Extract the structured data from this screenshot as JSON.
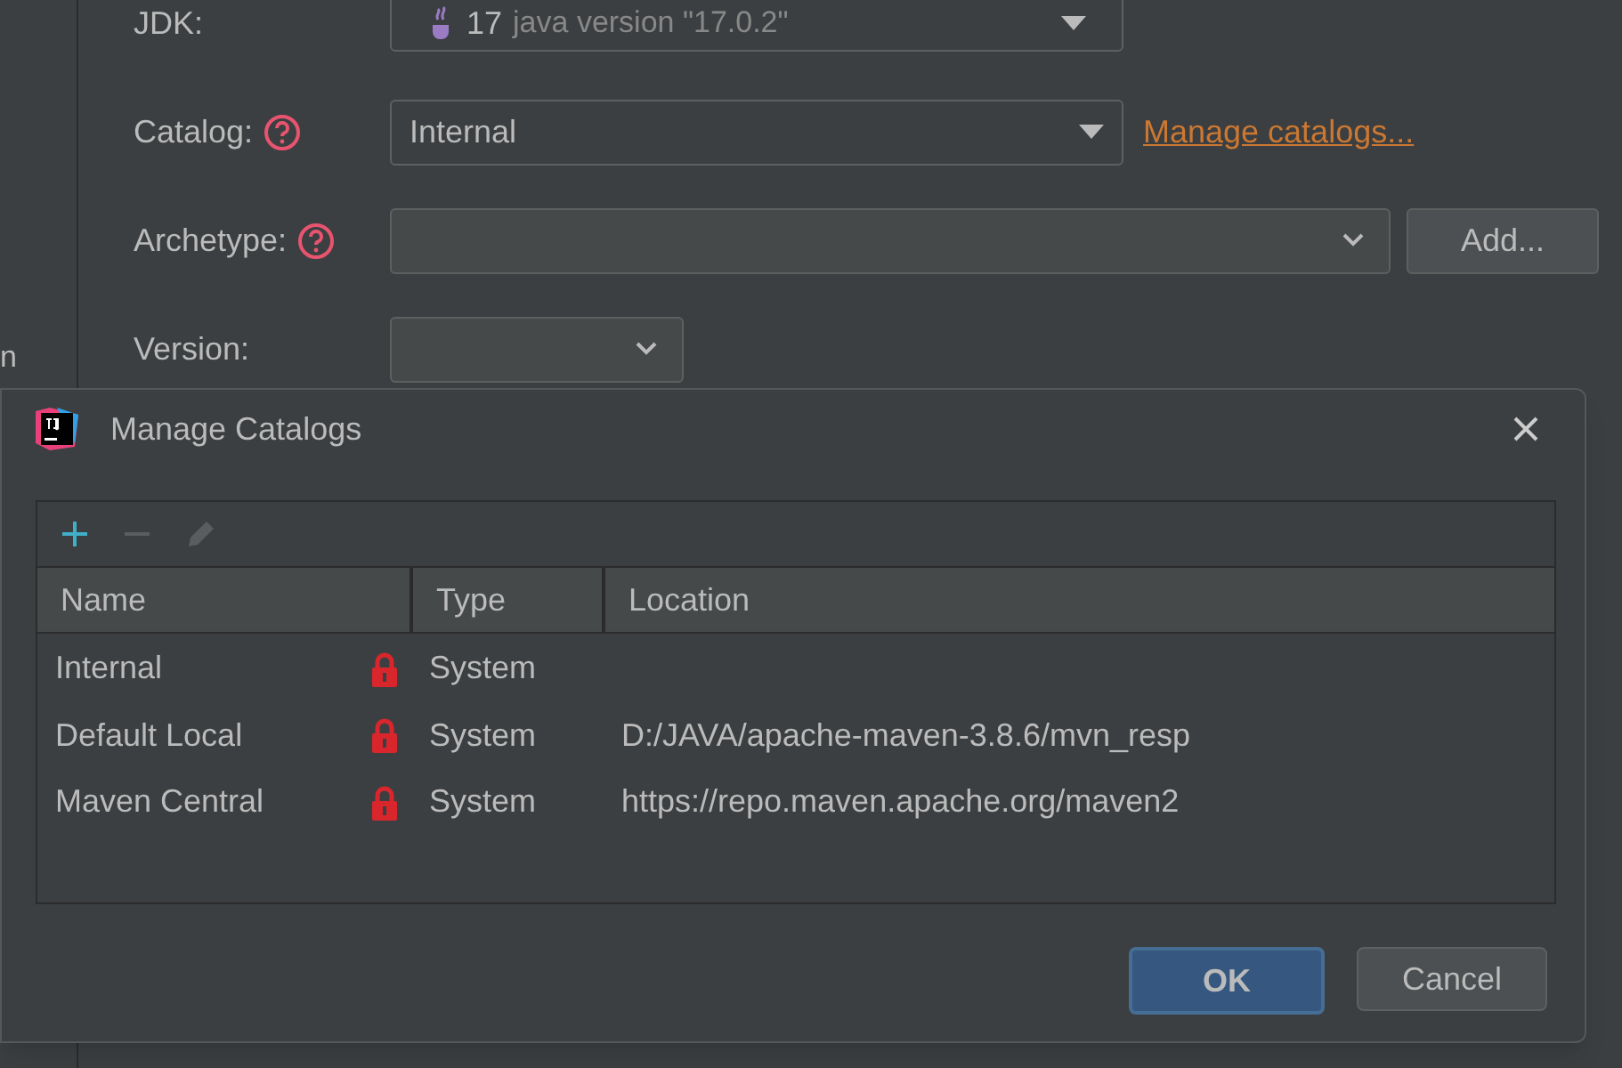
{
  "sidebar": {
    "cut_text": "n"
  },
  "form": {
    "jdk": {
      "label": "JDK:",
      "version": "17",
      "detail": "java version \"17.0.2\""
    },
    "catalog": {
      "label": "Catalog:",
      "help": true,
      "value": "Internal",
      "link": "Manage catalogs..."
    },
    "archetype": {
      "label": "Archetype:",
      "help": true,
      "button": "Add..."
    },
    "version": {
      "label": "Version:"
    }
  },
  "dialog": {
    "title": "Manage Catalogs",
    "toolbar": [
      {
        "kind": "add",
        "disabled": false
      },
      {
        "kind": "remove",
        "disabled": true
      },
      {
        "kind": "edit",
        "disabled": true
      }
    ],
    "table": {
      "columns": [
        "Name",
        "Type",
        "Location"
      ],
      "rows": [
        {
          "name": "Internal",
          "locked": true,
          "type": "System"
        },
        {
          "name": "Default Local",
          "locked": true,
          "type": "System",
          "location": "D:/JAVA/apache-maven-3.8.6/mvn_resp"
        },
        {
          "name": "Maven Central",
          "locked": true,
          "type": "System",
          "location": "https://repo.maven.apache.org/maven2"
        }
      ]
    },
    "buttons": [
      {
        "label": "OK",
        "default": true
      },
      {
        "label": "Cancel",
        "default": false
      }
    ]
  }
}
